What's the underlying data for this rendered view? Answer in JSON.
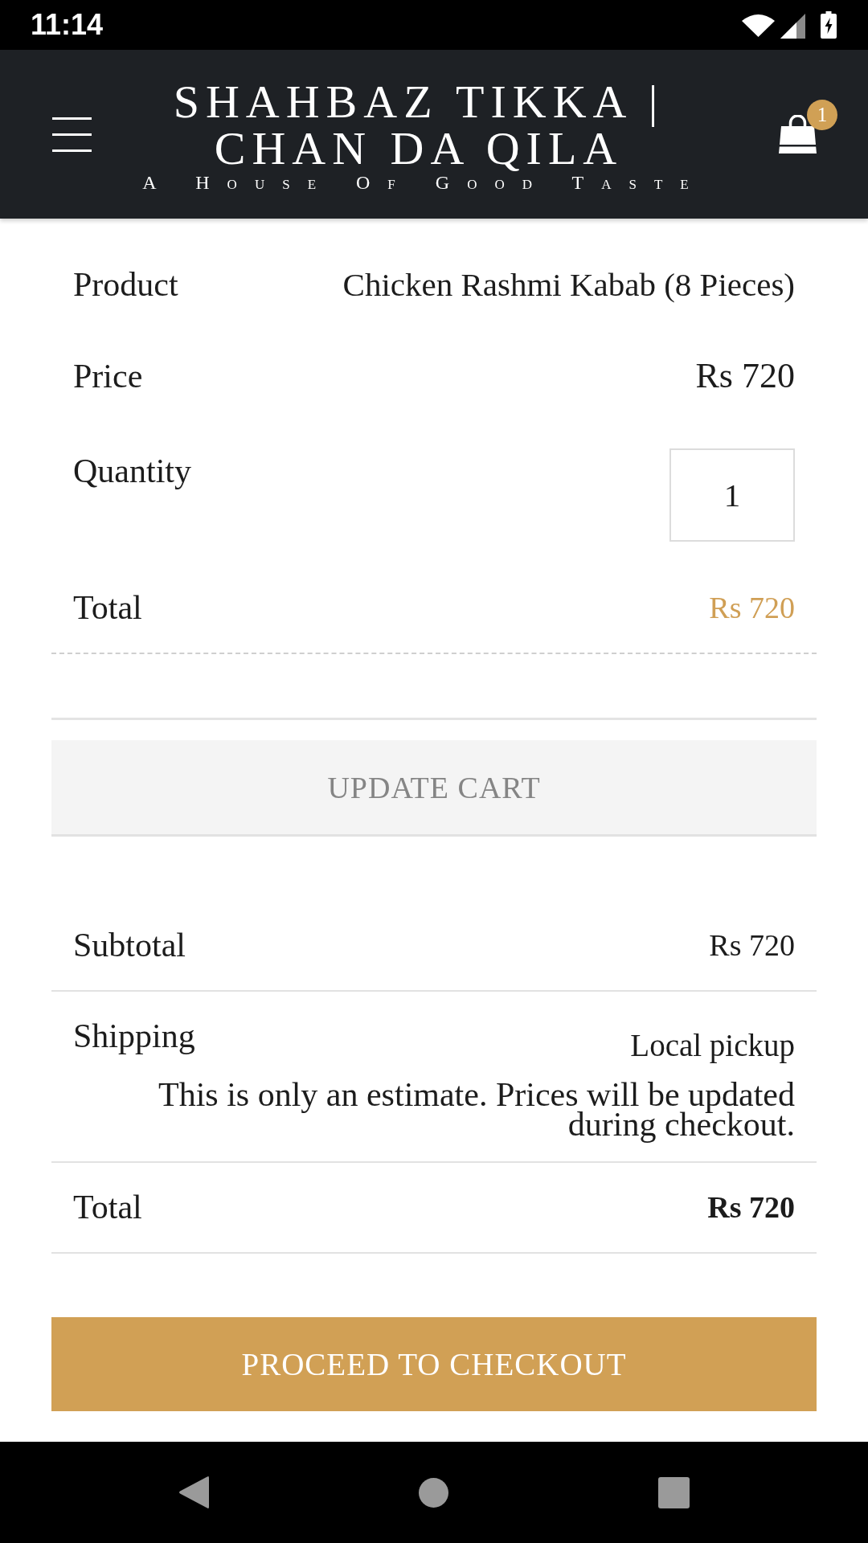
{
  "status_bar": {
    "time": "11:14"
  },
  "header": {
    "title": "SHAHBAZ TIKKA | CHAN DA QILA",
    "tagline": "A House Of Good Taste",
    "cart_count": "1"
  },
  "cart_item": [
    {
      "kind": "text",
      "label": "Product",
      "value": "Chicken Rashmi Kabab (8 Pieces)"
    },
    {
      "kind": "price",
      "label": "Price",
      "value": "Rs 720"
    },
    {
      "kind": "quantity",
      "label": "Quantity",
      "value": "1"
    },
    {
      "kind": "total",
      "label": "Total",
      "value": "Rs 720"
    }
  ],
  "update_button": {
    "label": "UPDATE CART",
    "disabled": true
  },
  "cart_totals": [
    {
      "kind": "subtotal",
      "label": "Subtotal",
      "value": "Rs 720"
    },
    {
      "kind": "shipping",
      "label": "Shipping",
      "value": "Local pickup",
      "note": "This is only an estimate. Prices will be updated during checkout."
    },
    {
      "kind": "total",
      "label": "Total",
      "value": "Rs 720"
    }
  ],
  "checkout_button": {
    "label": "PROCEED TO CHECKOUT"
  }
}
